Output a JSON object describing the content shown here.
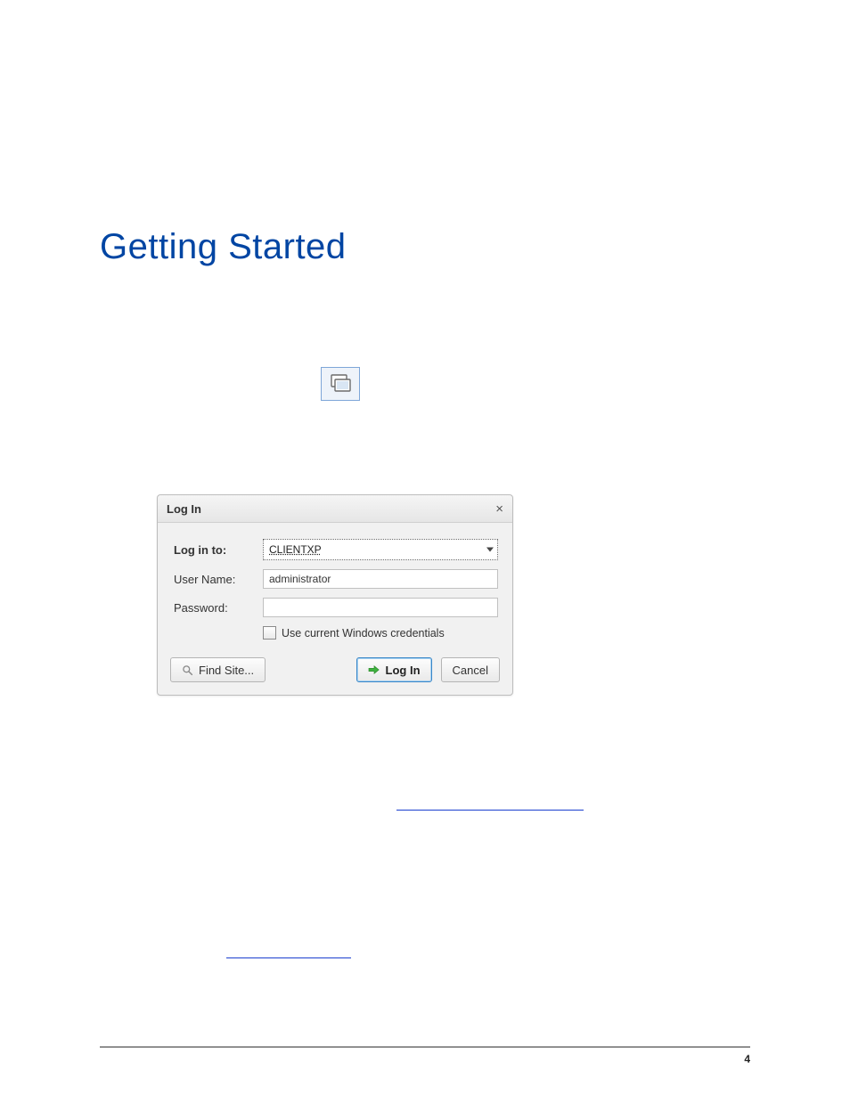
{
  "heading": "Getting Started",
  "dialog": {
    "title": "Log In",
    "close_glyph": "×",
    "fields": {
      "login_to_label": "Log in to:",
      "login_to_value": "CLIENTXP",
      "username_label": "User Name:",
      "username_value": "administrator",
      "password_label": "Password:",
      "password_value": ""
    },
    "checkbox_label": "Use current Windows credentials",
    "buttons": {
      "find_site": "Find Site...",
      "login": "Log In",
      "cancel": "Cancel"
    }
  },
  "page_number": "4"
}
